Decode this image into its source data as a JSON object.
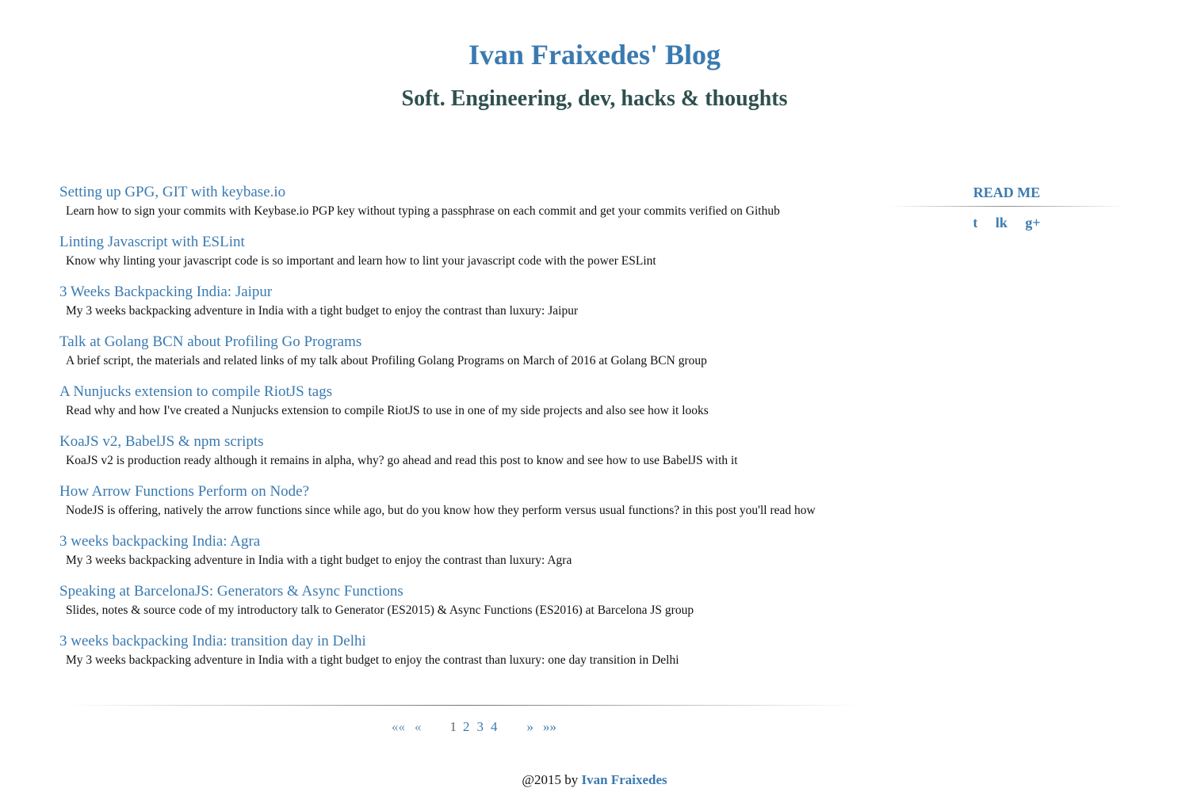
{
  "header": {
    "title": "Ivan Fraixedes' Blog",
    "tagline": "Soft. Engineering, dev, hacks & thoughts"
  },
  "posts": [
    {
      "title": "Setting up GPG, GIT with keybase.io",
      "summary": "Learn how to sign your commits with Keybase.io PGP key without typing a passphrase on each commit and get your commits verified on Github"
    },
    {
      "title": "Linting Javascript with ESLint",
      "summary": "Know why linting your javascript code is so important and learn how to lint your javascript code with the power ESLint"
    },
    {
      "title": "3 Weeks Backpacking India: Jaipur",
      "summary": "My 3 weeks backpacking adventure in India with a tight budget to enjoy the contrast than luxury: Jaipur"
    },
    {
      "title": "Talk at Golang BCN about Profiling Go Programs",
      "summary": "A brief script, the materials and related links of my talk about Profiling Golang Programs on March of 2016 at Golang BCN group"
    },
    {
      "title": "A Nunjucks extension to compile RiotJS tags",
      "summary": "Read why and how I've created a Nunjucks extension to compile RiotJS to use in one of my side projects and also see how it looks"
    },
    {
      "title": "KoaJS v2, BabelJS & npm scripts",
      "summary": "KoaJS v2 is production ready although it remains in alpha, why? go ahead and read this post to know and see how to use BabelJS with it"
    },
    {
      "title": "How Arrow Functions Perform on Node?",
      "summary": "NodeJS is offering, natively the arrow functions since while ago, but do you know how they perform versus usual functions? in this post you'll read how"
    },
    {
      "title": "3 weeks backpacking India: Agra",
      "summary": "My 3 weeks backpacking adventure in India with a tight budget to enjoy the contrast than luxury: Agra"
    },
    {
      "title": "Speaking at BarcelonaJS: Generators & Async Functions",
      "summary": "Slides, notes & source code of my introductory talk to Generator (ES2015) & Async Functions (ES2016) at Barcelona JS group"
    },
    {
      "title": "3 weeks backpacking India: transition day in Delhi",
      "summary": "My 3 weeks backpacking adventure in India with a tight budget to enjoy the contrast than luxury: one day transition in Delhi"
    }
  ],
  "pagination": {
    "first": "««",
    "prev": "«",
    "pages": [
      "1",
      "2",
      "3",
      "4"
    ],
    "current_page": "1",
    "next": "»",
    "last": "»»"
  },
  "sidebar": {
    "heading": "READ ME",
    "social": [
      {
        "label": "t",
        "icon": "twitter-icon"
      },
      {
        "label": "lk",
        "icon": "linkedin-icon"
      },
      {
        "label": "g+",
        "icon": "google-plus-icon"
      }
    ]
  },
  "footer": {
    "prefix": "@2015 by",
    "author": "Ivan Fraixedes"
  },
  "colors": {
    "link": "#3a7ab0",
    "tagline": "#2f4f4f",
    "text": "#111111"
  }
}
